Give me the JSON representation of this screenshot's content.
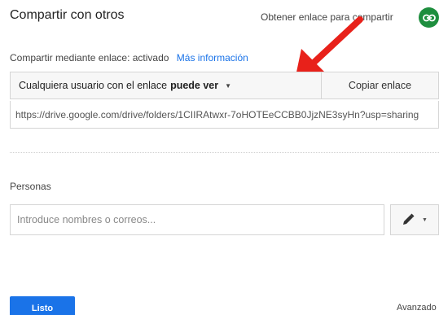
{
  "dialog": {
    "title": "Compartir con otros",
    "get_link_label": "Obtener enlace para compartir"
  },
  "link_sharing": {
    "status_text": "Compartir mediante enlace: activado",
    "more_info_label": "Más información",
    "access_prefix": "Cualquiera usuario con el enlace",
    "access_level": "puede ver",
    "copy_link_label": "Copiar enlace",
    "url": "https://drive.google.com/drive/folders/1CIIRAtwxr-7oHOTEeCCBB0JjzNE3syHn?usp=sharing"
  },
  "people": {
    "label": "Personas",
    "input_placeholder": "Introduce nombres o correos...",
    "input_value": ""
  },
  "footer": {
    "done_label": "Listo",
    "advanced_label": "Avanzado"
  },
  "colors": {
    "accent": "#1a73e8",
    "link_badge": "#1e8e3e",
    "annotation_arrow": "#e8211a"
  },
  "icons": {
    "link_badge": "link-icon",
    "permission": "pencil-icon",
    "dropdown": "caret-down-icon"
  }
}
